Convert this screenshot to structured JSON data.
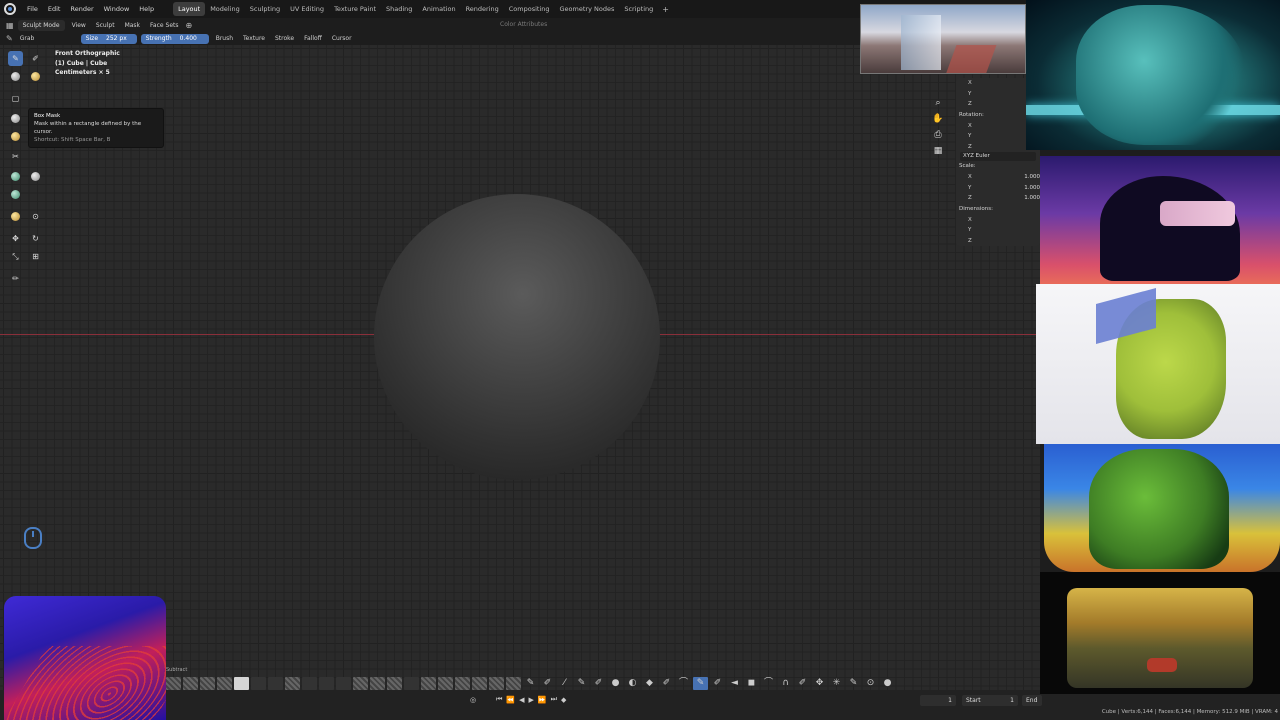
{
  "menubar": {
    "items": [
      "File",
      "Edit",
      "Render",
      "Window",
      "Help"
    ],
    "workspaces": [
      "Layout",
      "Modeling",
      "Sculpting",
      "UV Editing",
      "Texture Paint",
      "Shading",
      "Animation",
      "Rendering",
      "Compositing",
      "Geometry Nodes",
      "Scripting"
    ],
    "active_workspace": "Layout",
    "add": "+"
  },
  "header": {
    "mode": "Sculpt Mode",
    "menus": [
      "View",
      "Sculpt",
      "Mask",
      "Face Sets"
    ],
    "color_attributes": "Color Attributes"
  },
  "toolsettings": {
    "tool": "Grab",
    "size_label": "Size",
    "size_value": "252 px",
    "strength_label": "Strength",
    "strength_value": "0.400",
    "dropdowns": [
      "Brush",
      "Texture",
      "Stroke",
      "Falloff",
      "Cursor"
    ]
  },
  "viewport": {
    "view_name": "Front Orthographic",
    "object": "(1) Cube | Cube",
    "scale": "Centimeters × 5"
  },
  "tooltip": {
    "title": "Box Mask",
    "description": "Mask within a rectangle defined by the cursor.",
    "shortcut": "Shortcut: Shift Space Bar, B"
  },
  "npanel": {
    "location_rows": [
      "X",
      "Y",
      "Z"
    ],
    "rotation_label": "Rotation:",
    "rotation_rows": [
      "X",
      "Y",
      "Z"
    ],
    "rotation_mode": "XYZ Euler",
    "scale_label": "Scale:",
    "scale_rows": [
      {
        "axis": "X",
        "value": "1.000"
      },
      {
        "axis": "Y",
        "value": "1.000"
      },
      {
        "axis": "Z",
        "value": "1.000"
      }
    ],
    "dimensions_label": "Dimensions:",
    "dimension_rows": [
      "X",
      "Y",
      "Z"
    ]
  },
  "brush_strip": {
    "label": "Subtract"
  },
  "timeline": {
    "current_frame": "1",
    "start_label": "Start",
    "start_value": "1",
    "end_label": "End"
  },
  "status": {
    "text": "Cube | Verts:6,144 | Faces:6,144 | Memory: 512.9 MiB | VRAM: 4"
  }
}
